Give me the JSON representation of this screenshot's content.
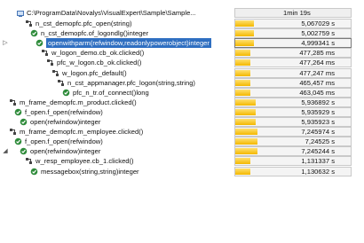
{
  "rows": [
    {
      "label": "C:\\ProgramData\\Novalys\\VisualExpert\\Sample\\Sample...",
      "value": "1min 19s",
      "fill": 1.0,
      "icon": "root-icon",
      "toggle": "",
      "selected": false
    },
    {
      "label": "n_cst_demopfc.pfc_open(string)",
      "value": "5,067029 s",
      "fill": 0.064,
      "icon": "event-icon",
      "toggle": "",
      "selected": false
    },
    {
      "label": "n_cst_demopfc.of_logondlg()integer",
      "value": "5,002759 s",
      "fill": 0.063,
      "icon": "function-icon",
      "toggle": "",
      "selected": false
    },
    {
      "label": "openwithparm(refwindow,readonlypowerobject)integer",
      "value": "4,999341 s",
      "fill": 0.063,
      "icon": "function-icon",
      "toggle": "▷",
      "selected": true
    },
    {
      "label": "w_logon_demo.cb_ok.clicked()",
      "value": "477,285 ms",
      "fill": 0.006,
      "icon": "event-icon",
      "toggle": "",
      "selected": false
    },
    {
      "label": "pfc_w_logon.cb_ok.clicked()",
      "value": "477,264 ms",
      "fill": 0.006,
      "icon": "event-icon",
      "toggle": "",
      "selected": false
    },
    {
      "label": "w_logon.pfc_default()",
      "value": "477,247 ms",
      "fill": 0.006,
      "icon": "event-icon",
      "toggle": "",
      "selected": false
    },
    {
      "label": "n_cst_appmanager.pfc_logon(string,string)",
      "value": "465,457 ms",
      "fill": 0.006,
      "icon": "event-icon",
      "toggle": "",
      "selected": false
    },
    {
      "label": "pfc_n_tr.of_connect()long",
      "value": "463,045 ms",
      "fill": 0.006,
      "icon": "function-icon",
      "toggle": "",
      "selected": false
    },
    {
      "label": "m_frame_demopfc.m_product.clicked()",
      "value": "5,936892 s",
      "fill": 0.075,
      "icon": "event-icon",
      "toggle": "",
      "selected": false
    },
    {
      "label": "f_open.f_open(refwindow)",
      "value": "5,935929 s",
      "fill": 0.075,
      "icon": "function-icon",
      "toggle": "",
      "selected": false
    },
    {
      "label": "open(refwindow)integer",
      "value": "5,935923 s",
      "fill": 0.075,
      "icon": "function-icon",
      "toggle": "",
      "selected": false
    },
    {
      "label": "m_frame_demopfc.m_employee.clicked()",
      "value": "7,245974 s",
      "fill": 0.092,
      "icon": "event-icon",
      "toggle": "",
      "selected": false
    },
    {
      "label": "f_open.f_open(refwindow)",
      "value": "7,24525 s",
      "fill": 0.092,
      "icon": "function-icon",
      "toggle": "",
      "selected": false
    },
    {
      "label": "open(refwindow)integer",
      "value": "7,245244 s",
      "fill": 0.092,
      "icon": "function-icon",
      "toggle": "◢",
      "selected": false
    },
    {
      "label": "w_resp_employee.cb_1.clicked()",
      "value": "1,131337 s",
      "fill": 0.014,
      "icon": "event-icon",
      "toggle": "",
      "selected": false
    },
    {
      "label": "messagebox(string,string)integer",
      "value": "1,130632 s",
      "fill": 0.014,
      "icon": "function-icon",
      "toggle": "",
      "selected": false
    }
  ]
}
